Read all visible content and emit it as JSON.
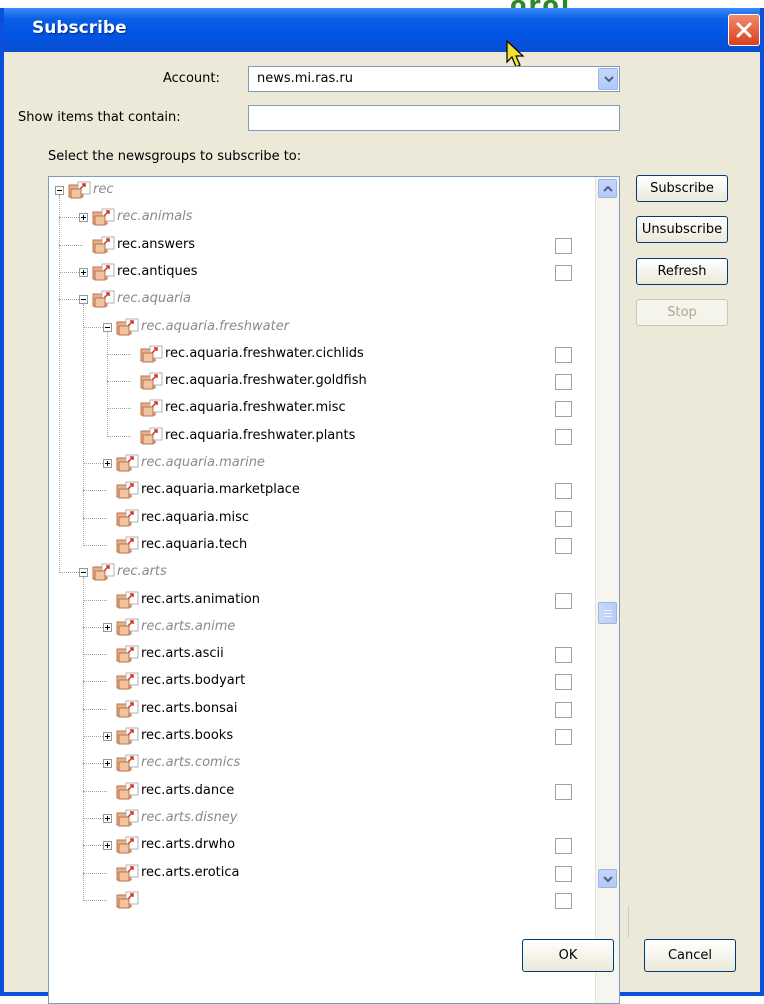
{
  "window": {
    "title": "Subscribe"
  },
  "account": {
    "label": "Account:",
    "value": "news.mi.ras.ru"
  },
  "filter": {
    "label": "Show items that contain:",
    "value": ""
  },
  "list": {
    "label": "Select the newsgroups to subscribe to:"
  },
  "buttons": {
    "subscribe": "Subscribe",
    "unsubscribe": "Unsubscribe",
    "refresh": "Refresh",
    "stop": "Stop",
    "ok": "OK",
    "cancel": "Cancel"
  },
  "tree": [
    {
      "label": "rec",
      "level": 0,
      "category": true,
      "expander": "minus",
      "checkbox": false
    },
    {
      "label": "rec.animals",
      "level": 1,
      "category": true,
      "expander": "plus",
      "checkbox": false
    },
    {
      "label": "rec.answers",
      "level": 1,
      "category": false,
      "expander": "none",
      "checkbox": true
    },
    {
      "label": "rec.antiques",
      "level": 1,
      "category": false,
      "expander": "plus",
      "checkbox": true
    },
    {
      "label": "rec.aquaria",
      "level": 1,
      "category": true,
      "expander": "minus",
      "checkbox": false
    },
    {
      "label": "rec.aquaria.freshwater",
      "level": 2,
      "category": true,
      "expander": "minus",
      "checkbox": false
    },
    {
      "label": "rec.aquaria.freshwater.cichlids",
      "level": 3,
      "category": false,
      "expander": "none",
      "checkbox": true
    },
    {
      "label": "rec.aquaria.freshwater.goldfish",
      "level": 3,
      "category": false,
      "expander": "none",
      "checkbox": true
    },
    {
      "label": "rec.aquaria.freshwater.misc",
      "level": 3,
      "category": false,
      "expander": "none",
      "checkbox": true
    },
    {
      "label": "rec.aquaria.freshwater.plants",
      "level": 3,
      "category": false,
      "expander": "none",
      "checkbox": true
    },
    {
      "label": "rec.aquaria.marine",
      "level": 2,
      "category": true,
      "expander": "plus",
      "checkbox": false
    },
    {
      "label": "rec.aquaria.marketplace",
      "level": 2,
      "category": false,
      "expander": "none",
      "checkbox": true
    },
    {
      "label": "rec.aquaria.misc",
      "level": 2,
      "category": false,
      "expander": "none",
      "checkbox": true
    },
    {
      "label": "rec.aquaria.tech",
      "level": 2,
      "category": false,
      "expander": "none",
      "checkbox": true
    },
    {
      "label": "rec.arts",
      "level": 1,
      "category": true,
      "expander": "minus",
      "checkbox": false
    },
    {
      "label": "rec.arts.animation",
      "level": 2,
      "category": false,
      "expander": "none",
      "checkbox": true
    },
    {
      "label": "rec.arts.anime",
      "level": 2,
      "category": true,
      "expander": "plus",
      "checkbox": false
    },
    {
      "label": "rec.arts.ascii",
      "level": 2,
      "category": false,
      "expander": "none",
      "checkbox": true
    },
    {
      "label": "rec.arts.bodyart",
      "level": 2,
      "category": false,
      "expander": "none",
      "checkbox": true
    },
    {
      "label": "rec.arts.bonsai",
      "level": 2,
      "category": false,
      "expander": "none",
      "checkbox": true
    },
    {
      "label": "rec.arts.books",
      "level": 2,
      "category": false,
      "expander": "plus",
      "checkbox": true
    },
    {
      "label": "rec.arts.comics",
      "level": 2,
      "category": true,
      "expander": "plus",
      "checkbox": false
    },
    {
      "label": "rec.arts.dance",
      "level": 2,
      "category": false,
      "expander": "none",
      "checkbox": true
    },
    {
      "label": "rec.arts.disney",
      "level": 2,
      "category": true,
      "expander": "plus",
      "checkbox": false
    },
    {
      "label": "rec.arts.drwho",
      "level": 2,
      "category": false,
      "expander": "plus",
      "checkbox": true
    },
    {
      "label": "rec.arts.erotica",
      "level": 2,
      "category": false,
      "expander": "none",
      "checkbox": true
    },
    {
      "label": "",
      "level": 2,
      "category": false,
      "expander": "none",
      "checkbox": true
    }
  ],
  "colors": {
    "title_bar": "#0054e3",
    "dialog_bg": "#ece9d8",
    "close_button": "#d8401f",
    "category_text": "#8a8a8a"
  }
}
